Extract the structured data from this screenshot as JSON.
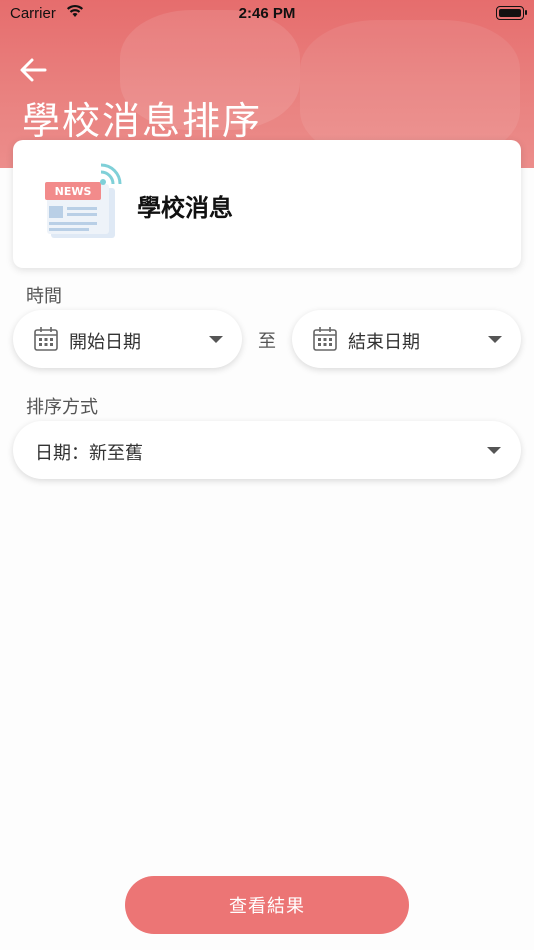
{
  "status_bar": {
    "carrier": "Carrier",
    "time": "2:46 PM"
  },
  "header": {
    "title": "學校消息排序"
  },
  "card": {
    "title": "學校消息",
    "icon_label": "NEWS"
  },
  "time_section": {
    "label": "時間",
    "start_placeholder": "開始日期",
    "separator": "至",
    "end_placeholder": "結束日期"
  },
  "sort_section": {
    "label": "排序方式",
    "selected": "日期：新至舊"
  },
  "submit": {
    "label": "查看結果"
  },
  "colors": {
    "accent": "#ec7575",
    "header": "#e8787a"
  }
}
